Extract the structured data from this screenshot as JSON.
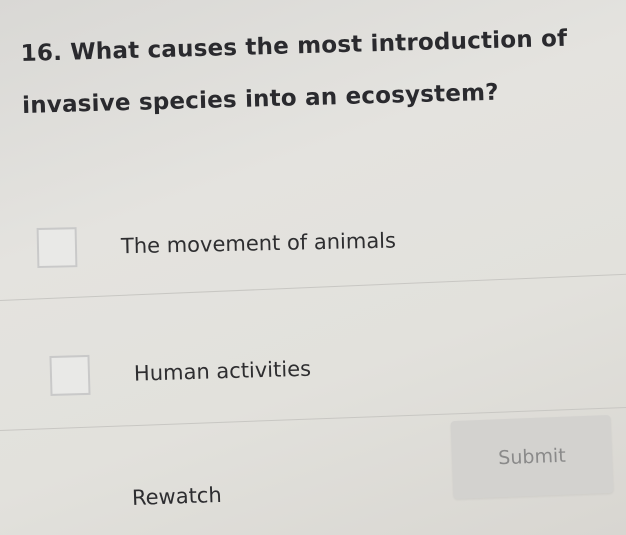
{
  "question": {
    "number": "16.",
    "text": "What causes the most introduction of invasive species into an ecosystem?"
  },
  "options": [
    {
      "label": "The movement of animals",
      "checked": false
    },
    {
      "label": "Human activities",
      "checked": false
    }
  ],
  "actions": {
    "submit_label": "Submit",
    "rewatch_label": "Rewatch"
  }
}
